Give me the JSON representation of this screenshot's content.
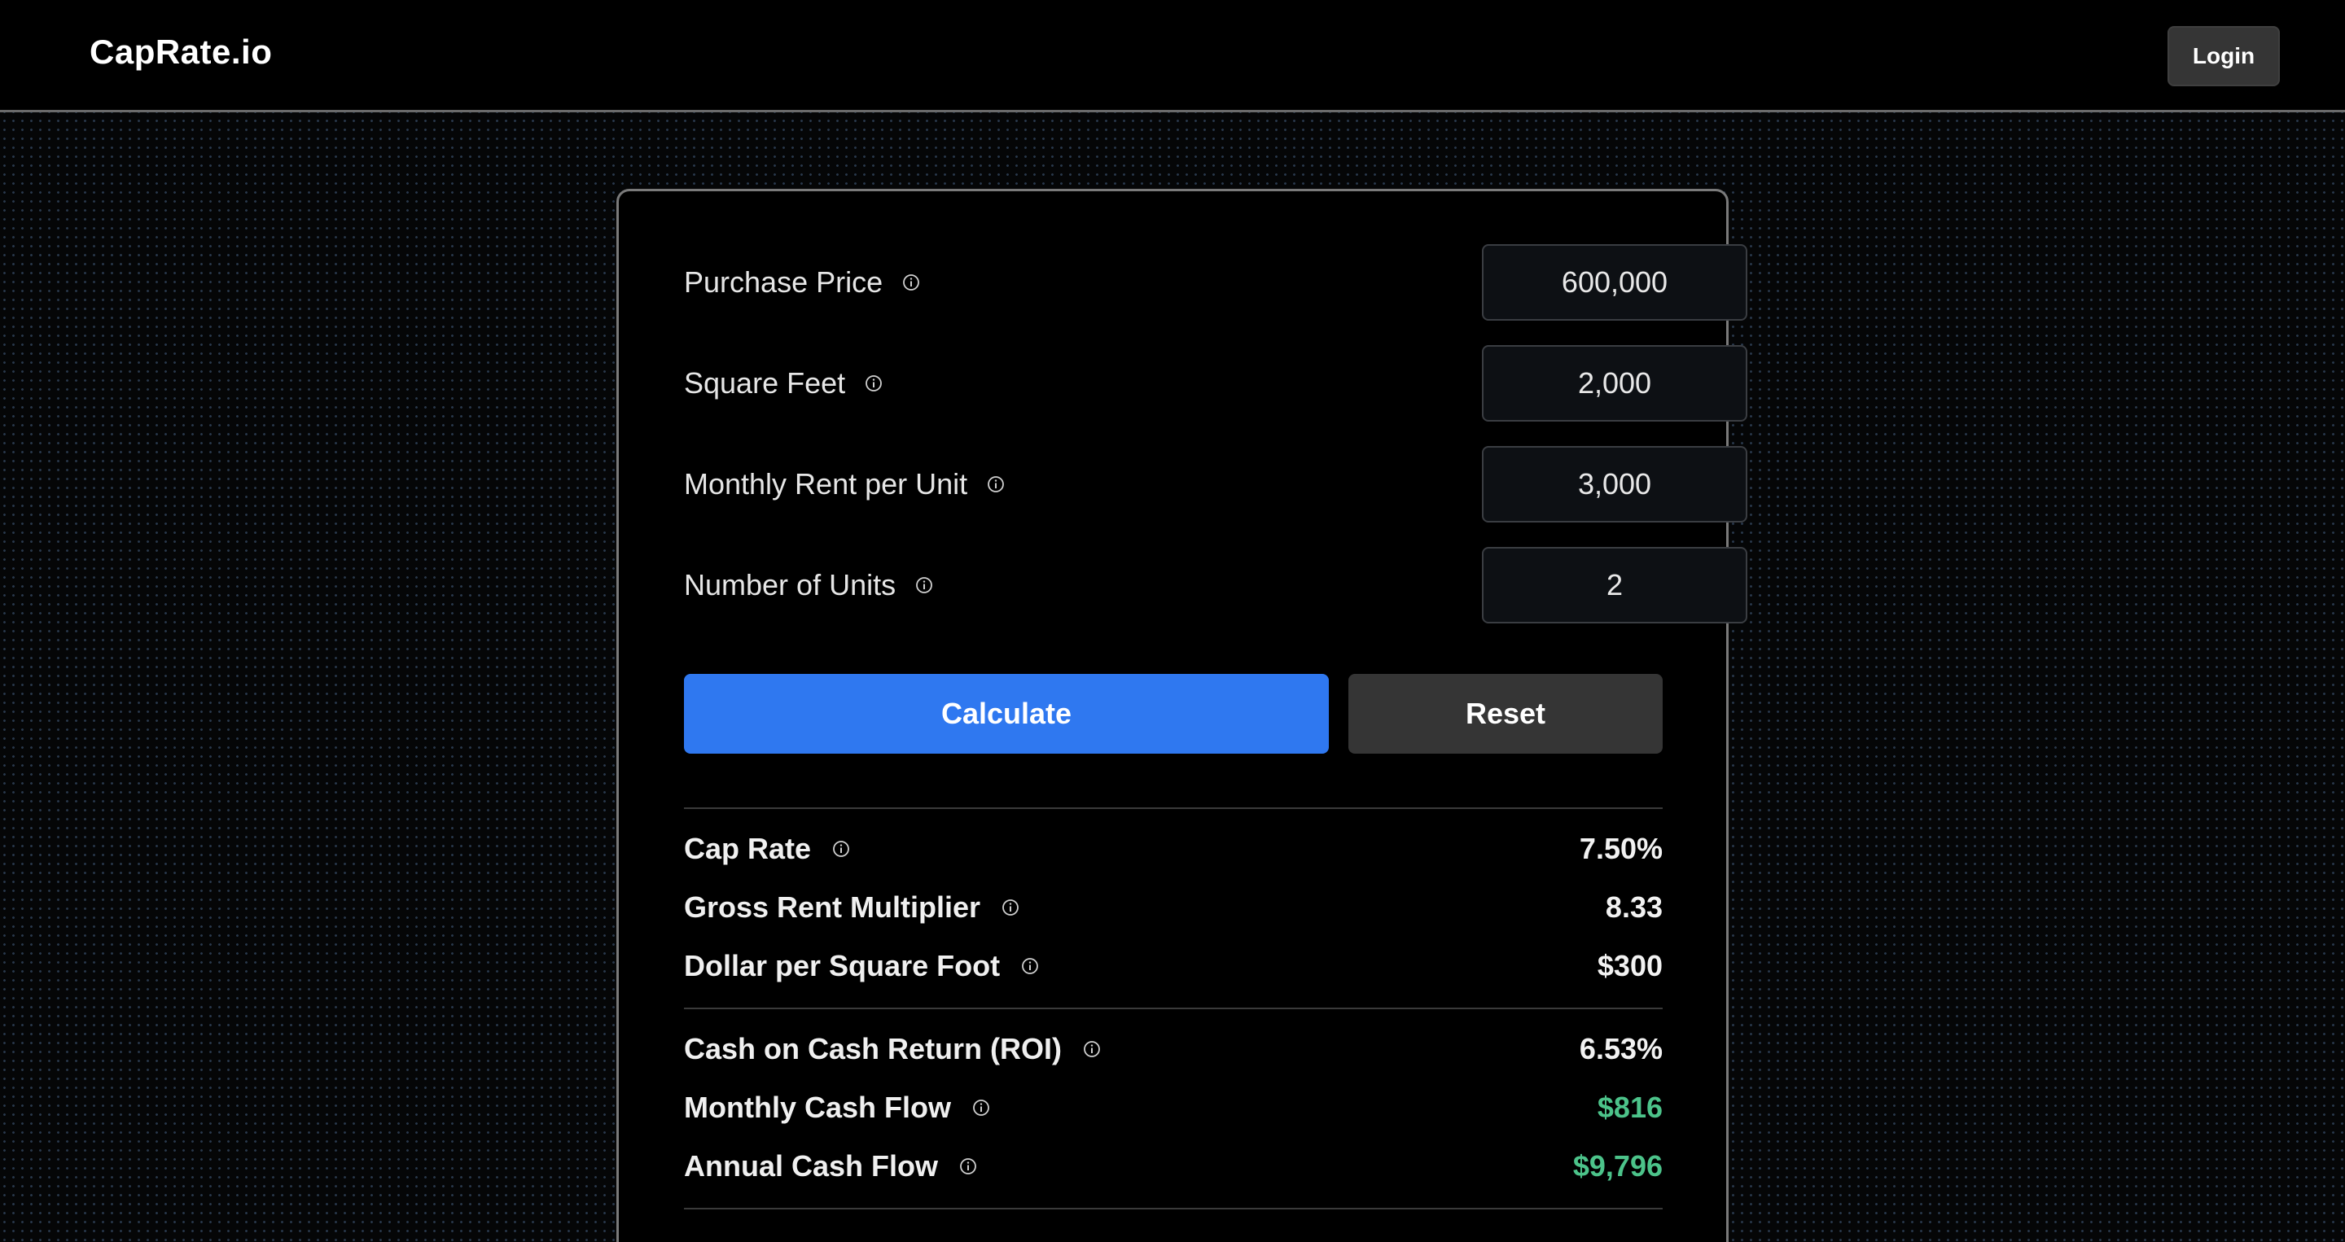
{
  "header": {
    "brand": "CapRate.io",
    "login_label": "Login"
  },
  "inputs": [
    {
      "label": "Purchase Price",
      "value": "600,000"
    },
    {
      "label": "Square Feet",
      "value": "2,000"
    },
    {
      "label": "Monthly Rent per Unit",
      "value": "3,000"
    },
    {
      "label": "Number of Units",
      "value": "2"
    }
  ],
  "actions": {
    "calculate_label": "Calculate",
    "reset_label": "Reset"
  },
  "results": {
    "cap_rate": {
      "label": "Cap Rate",
      "value": "7.50%"
    },
    "gross_rent_multiplier": {
      "label": "Gross Rent Multiplier",
      "value": "8.33"
    },
    "dollar_per_sqft": {
      "label": "Dollar per Square Foot",
      "value": "$300"
    },
    "cash_on_cash": {
      "label": "Cash on Cash Return (ROI)",
      "value": "6.53%"
    },
    "monthly_cash_flow": {
      "label": "Monthly Cash Flow",
      "value": "$816"
    },
    "annual_cash_flow": {
      "label": "Annual Cash Flow",
      "value": "$9,796"
    }
  },
  "colors": {
    "accent": "#2f78f0",
    "positive": "#4cc38a",
    "card_border": "#7a7a7a",
    "secondary_button": "#353535"
  },
  "icons": {
    "info": "info-circle-icon"
  }
}
